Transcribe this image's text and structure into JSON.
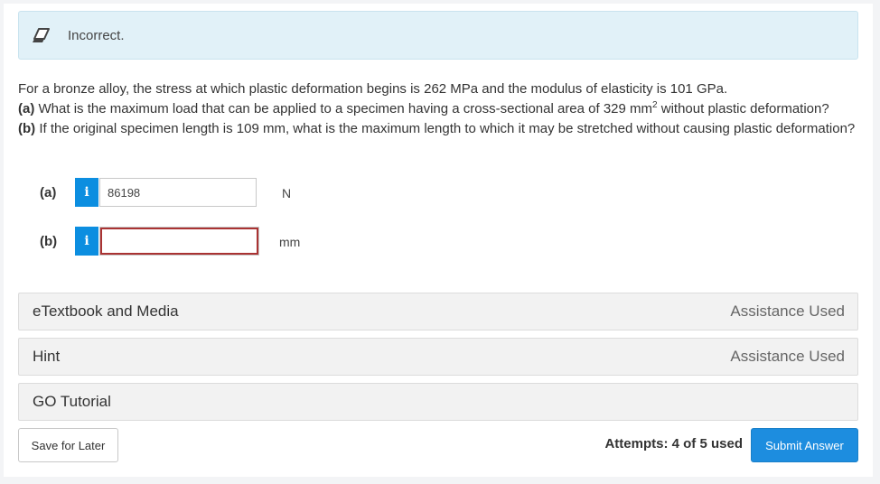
{
  "alert": {
    "icon": "eraser-icon",
    "message": "Incorrect."
  },
  "question": {
    "intro": "For a bronze alloy, the stress at which plastic deformation begins is 262 MPa and the modulus of elasticity is 101 GPa.",
    "part_a_label": "(a)",
    "part_a_text_before": " What is the maximum load that can be applied to a specimen having a cross-sectional area of 329 mm",
    "part_a_sup": "2",
    "part_a_text_after": " without plastic deformation?",
    "part_b_label": "(b)",
    "part_b_text": " If the original specimen length is 109 mm, what is the maximum length to which it may be stretched without causing plastic deformation?"
  },
  "answers": [
    {
      "label": "(a)",
      "info_icon": "i",
      "value": "86198",
      "unit": "N"
    },
    {
      "label": "(b)",
      "info_icon": "i",
      "value": "",
      "unit": "mm"
    }
  ],
  "panels": [
    {
      "title": "eTextbook and Media",
      "status": "Assistance Used"
    },
    {
      "title": "Hint",
      "status": "Assistance Used"
    },
    {
      "title": "GO Tutorial",
      "status": ""
    }
  ],
  "footer": {
    "save_label": "Save for Later",
    "attempts": "Attempts: 4 of 5 used",
    "submit_label": "Submit Answer"
  },
  "colors": {
    "alert_bg": "#e1f1f8",
    "info_blue": "#0c8ee0",
    "submit_blue": "#1d8ddf",
    "invalid_border": "#aa3333"
  }
}
